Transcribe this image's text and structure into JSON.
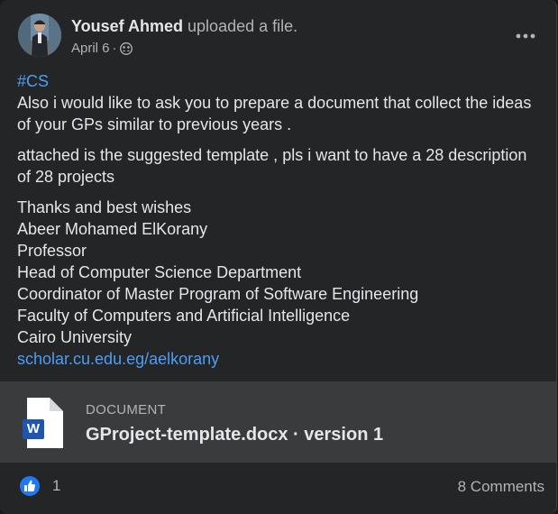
{
  "post": {
    "author": "Yousef Ahmed",
    "action": "uploaded a file.",
    "date": "April 6",
    "separator": "·",
    "audience_icon": "group-audience-icon",
    "more_icon": "more-options-icon"
  },
  "content": {
    "hashtag": "#CS",
    "paragraph1": "Also i would like to ask you to prepare a document that collect the ideas of your GPs similar to previous years .",
    "paragraph2": "attached is the suggested template , pls i want to have a 28 description of 28 projects",
    "signature": {
      "line1": "Thanks and best wishes",
      "line2": "Abeer Mohamed ElKorany",
      "line3": "Professor",
      "line4": "Head of Computer Science Department",
      "line5": "Coordinator of Master Program of Software Engineering",
      "line6": "Faculty of Computers and Artificial Intelligence",
      "line7": "Cairo University"
    },
    "link": "scholar.cu.edu.eg/aelkorany"
  },
  "attachment": {
    "type_label": "DOCUMENT",
    "title": "GProject-template.docx · version 1",
    "icon_letter": "W",
    "icon": "word-document-icon"
  },
  "footer": {
    "reaction_icon": "like-icon",
    "reaction_count": "1",
    "comments": "8 Comments"
  },
  "colors": {
    "card_background": "#242526",
    "page_background": "#18191a",
    "primary_text": "#e4e6eb",
    "secondary_text": "#b0b3b8",
    "link": "#4e9df5",
    "attachment_background": "#3a3b3c",
    "like_blue": "#2078f4",
    "word_blue": "#1e55b3"
  }
}
